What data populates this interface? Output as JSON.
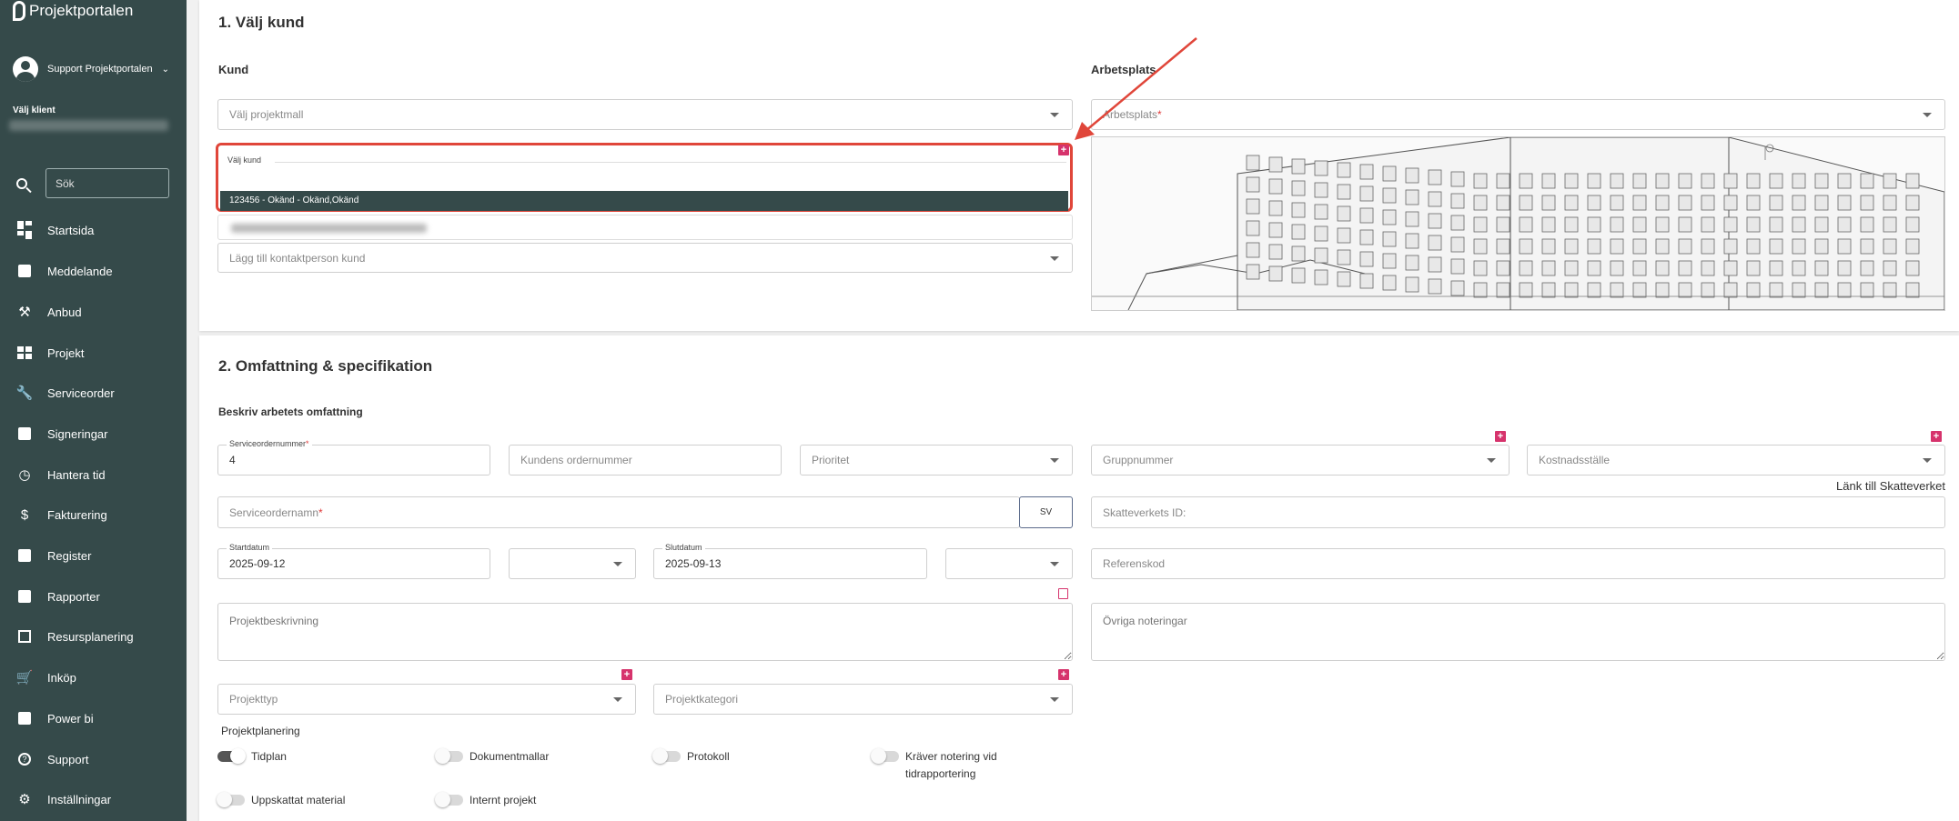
{
  "app": {
    "logo_text": "Projektportalen"
  },
  "user": {
    "name": "Support Projektportalen"
  },
  "client": {
    "label": "Välj klient"
  },
  "search": {
    "placeholder": "Sök"
  },
  "nav": [
    {
      "label": "Startsida",
      "icon": "dashboard-icon"
    },
    {
      "label": "Meddelande",
      "icon": "message-icon"
    },
    {
      "label": "Anbud",
      "icon": "gavel-icon"
    },
    {
      "label": "Projekt",
      "icon": "project-icon"
    },
    {
      "label": "Serviceorder",
      "icon": "wrench-icon"
    },
    {
      "label": "Signeringar",
      "icon": "signature-icon"
    },
    {
      "label": "Hantera tid",
      "icon": "clock-icon"
    },
    {
      "label": "Fakturering",
      "icon": "dollar-icon"
    },
    {
      "label": "Register",
      "icon": "image-icon"
    },
    {
      "label": "Rapporter",
      "icon": "calendar-icon"
    },
    {
      "label": "Resursplanering",
      "icon": "calendar-blank-icon"
    },
    {
      "label": "Inköp",
      "icon": "cart-icon"
    },
    {
      "label": "Power bi",
      "icon": "chart-icon"
    },
    {
      "label": "Support",
      "icon": "help-icon"
    },
    {
      "label": "Inställningar",
      "icon": "gear-icon"
    }
  ],
  "section1": {
    "title": "1. Välj kund",
    "kund_heading": "Kund",
    "arbetsplats_heading": "Arbetsplats",
    "projektmall_placeholder": "Välj projektmall",
    "valj_kund_label": "Välj kund",
    "kund_option": "123456 - Okänd - Okänd,Okänd",
    "kontaktperson_placeholder": "Lägg till kontaktperson kund",
    "arbetsplats_placeholder": "Arbetsplats",
    "required_mark": "*"
  },
  "section2": {
    "title": "2. Omfattning & specifikation",
    "scope_heading": "Beskriv arbetets omfattning",
    "serviceordernummer_label": "Serviceordernummer",
    "serviceordernummer_value": "4",
    "kundens_ordernummer_placeholder": "Kundens ordernummer",
    "prioritet_placeholder": "Prioritet",
    "gruppnummer_placeholder": "Gruppnummer",
    "kostnadsstalle_placeholder": "Kostnadsställe",
    "skatteverket_link": "Länk till Skatteverket",
    "serviceordernamn_placeholder": "Serviceordernamn",
    "language_button": "SV",
    "skatteverket_id_placeholder": "Skatteverkets ID:",
    "startdatum_label": "Startdatum",
    "startdatum_value": "2025-09-12",
    "slutdatum_label": "Slutdatum",
    "slutdatum_value": "2025-09-13",
    "referenskod_placeholder": "Referenskod",
    "projektbeskrivning_placeholder": "Projektbeskrivning",
    "ovriga_noteringar_placeholder": "Övriga noteringar",
    "projekttyp_placeholder": "Projekttyp",
    "projektkategori_placeholder": "Projektkategori",
    "projektplanering_label": "Projektplanering",
    "toggles": [
      {
        "label": "Tidplan",
        "on": true
      },
      {
        "label": "Dokumentmallar",
        "on": false
      },
      {
        "label": "Protokoll",
        "on": false
      },
      {
        "label": "Kräver notering vid tidrapportering",
        "on": false
      },
      {
        "label": "Uppskattat material",
        "on": false
      },
      {
        "label": "Internt projekt",
        "on": false
      }
    ]
  },
  "colors": {
    "sidebar": "#354a4a",
    "accent_pink": "#d6336c",
    "highlight_red": "#e0463a",
    "option_bg": "#354a4a"
  }
}
